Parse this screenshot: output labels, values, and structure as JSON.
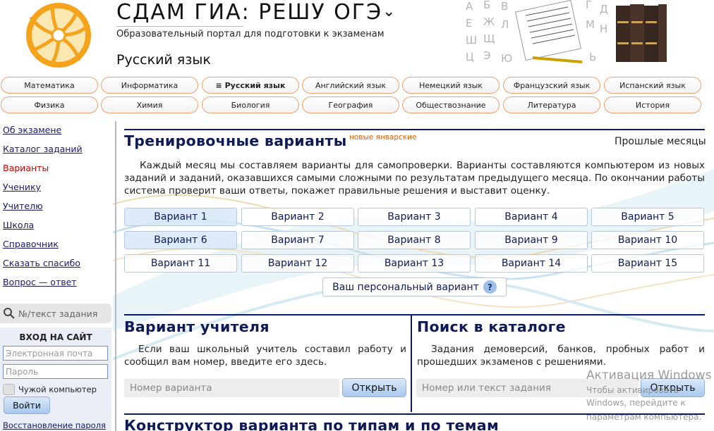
{
  "header": {
    "site_title": "СДАМ ГИА: РЕШУ ОГЭ",
    "chevron": "⌄",
    "subtitle": "Образовательный портал для подготовки к экзаменам",
    "subject": "Русский язык",
    "art_letters": [
      "А",
      "Б",
      "В",
      "Г",
      "Д",
      "Е",
      "Ж",
      "Л",
      "М",
      "Н",
      "Ш",
      "Щ",
      "Ц",
      "Э",
      "Ю",
      "Ь"
    ]
  },
  "subjects_row1": [
    {
      "label": "Математика",
      "active": false
    },
    {
      "label": "Информатика",
      "active": false
    },
    {
      "label": "≡ Русский язык",
      "active": true
    },
    {
      "label": "Английский язык",
      "active": false
    },
    {
      "label": "Немецкий язык",
      "active": false
    },
    {
      "label": "Французский язык",
      "active": false
    },
    {
      "label": "Испанский язык",
      "active": false
    }
  ],
  "subjects_row2": [
    {
      "label": "Физика"
    },
    {
      "label": "Химия"
    },
    {
      "label": "Биология"
    },
    {
      "label": "География"
    },
    {
      "label": "Обществознание"
    },
    {
      "label": "Литература"
    },
    {
      "label": "История"
    }
  ],
  "sidebar": {
    "links": [
      {
        "label": "Об экзамене",
        "current": false
      },
      {
        "label": "Каталог заданий",
        "current": false
      },
      {
        "label": "Варианты",
        "current": true
      },
      {
        "label": "Ученику",
        "current": false
      },
      {
        "label": "Учителю",
        "current": false
      },
      {
        "label": "Школа",
        "current": false
      },
      {
        "label": "Справочник",
        "current": false
      },
      {
        "label": "Сказать спасибо",
        "current": false
      },
      {
        "label": "Вопрос — ответ",
        "current": false
      }
    ],
    "search_placeholder": "№/текст задания",
    "login": {
      "title": "ВХОД НА САЙТ",
      "email_placeholder": "Электронная почта",
      "password_placeholder": "Пароль",
      "foreign_computer": "Чужой компьютер",
      "login_button": "Войти",
      "restore": "Восстановление пароля"
    }
  },
  "training": {
    "title": "Тренировочные варианты",
    "new_badge": "новые январские",
    "past_months": "Прошлые месяцы",
    "description": "Каждый месяц мы составляем варианты для самопроверки. Варианты составляются компьютером из новых заданий и заданий, оказавшихся самыми сложными по результатам предыдущего месяца. По окончании работы система проверит ваши ответы, покажет правильные решения и выставит оценку.",
    "variants": [
      {
        "label": "Вариант 1",
        "solved": true
      },
      {
        "label": "Вариант 2",
        "solved": false
      },
      {
        "label": "Вариант 3",
        "solved": false
      },
      {
        "label": "Вариант 4",
        "solved": false
      },
      {
        "label": "Вариант 5",
        "solved": false
      },
      {
        "label": "Вариант 6",
        "solved": true
      },
      {
        "label": "Вариант 7",
        "solved": false
      },
      {
        "label": "Вариант 8",
        "solved": false
      },
      {
        "label": "Вариант 9",
        "solved": false
      },
      {
        "label": "Вариант 10",
        "solved": false
      },
      {
        "label": "Вариант 11",
        "solved": false
      },
      {
        "label": "Вариант 12",
        "solved": false
      },
      {
        "label": "Вариант 13",
        "solved": false
      },
      {
        "label": "Вариант 14",
        "solved": false
      },
      {
        "label": "Вариант 15",
        "solved": false
      }
    ],
    "personal_variant": "Ваш персональный вариант",
    "help_mark": "?"
  },
  "teacher": {
    "title": "Вариант учителя",
    "description": "Если ваш школьный учитель составил работу и сообщил вам номер, введите его здесь.",
    "input_placeholder": "Номер варианта",
    "open_button": "Открыть"
  },
  "catalog": {
    "title": "Поиск в каталоге",
    "description": "Задания демоверсий, банков, пробных работ и прошедших экзаменов с решениями.",
    "input_placeholder": "Номер или текст задания",
    "open_button": "Открыть"
  },
  "constructor": {
    "title": "Конструктор варианта по типам и по темам"
  },
  "watermark": {
    "title": "Активация Windows",
    "line1": "Чтобы активировать Windows, перейдите к",
    "line2": "параметрам компьютера."
  }
}
